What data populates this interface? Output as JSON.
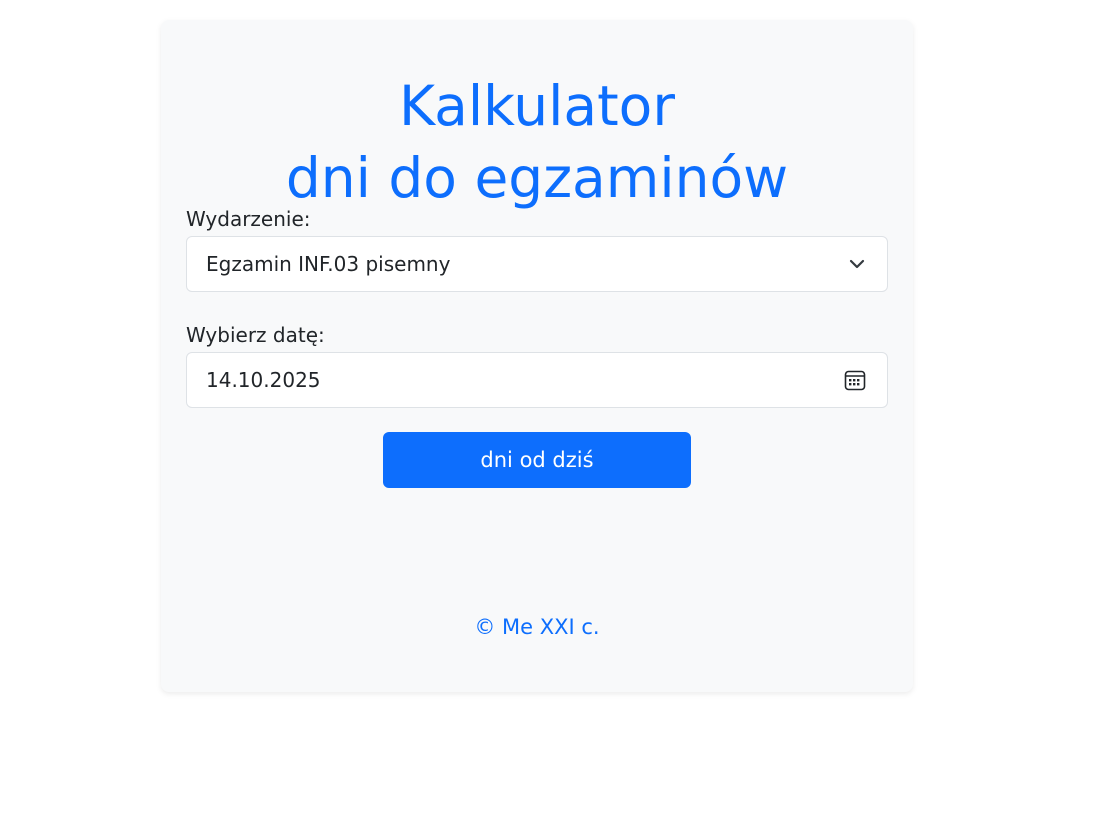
{
  "header": {
    "title_line1": "Kalkulator",
    "title_line2": "dni do egzaminów"
  },
  "form": {
    "event_label": "Wydarzenie:",
    "event_selected": "Egzamin INF.03 pisemny",
    "date_label": "Wybierz datę:",
    "date_value": "14.10.2025",
    "submit_label": "dni od dziś"
  },
  "footer": {
    "text": "© Me XXI c."
  },
  "icons": {
    "select": "chevron-down-icon",
    "date": "calendar-icon"
  },
  "colors": {
    "accent": "#0d6efd",
    "card_background": "#f8f9fa",
    "text": "#212529",
    "field_border": "#dee2e6"
  }
}
